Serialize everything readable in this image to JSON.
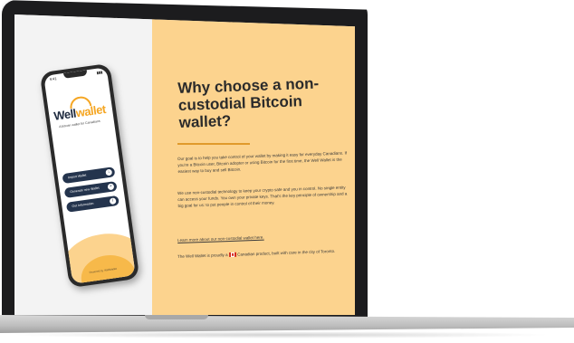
{
  "phone": {
    "time": "9:41",
    "status": "▮▮▮",
    "brand_main": "Well",
    "brand_accent": "wallet",
    "tagline": "A bitcoin wallet for Canadians",
    "buttons": [
      {
        "label": "Import Wallet",
        "icon": "download-icon",
        "glyph": "↓"
      },
      {
        "label": "Generate new Wallet",
        "icon": "plus-icon",
        "glyph": "+"
      },
      {
        "label": "Get Information",
        "icon": "info-icon",
        "glyph": "i"
      }
    ],
    "footer": "Powered by WellWallet"
  },
  "content": {
    "headline": "Why choose a non-custodial Bitcoin wallet?",
    "paragraphs": [
      "Our goal is to help you take control of your wallet by making it easy for everyday Canadians. If you're a Bitcoin user, Bitcoin adopter or using Bitcoin for the first time, the Well Wallet is the easiest way to buy and sell Bitcoin.",
      "We use non-custodial technology to keep your crypto safe and you in control. No single entity can access your funds. You own your private keys. That's the key principle of ownership and a big goal for us: to put people in control of their money.",
      "Learn more about our non-custodial wallet here."
    ],
    "canada_prefix": "The Well Wallet is proudly a",
    "canada_suffix": "Canadian product, built with care in the city of Toronto."
  },
  "colors": {
    "panel": "#fcd38e",
    "navy": "#24344d",
    "accent": "#f5a623"
  }
}
